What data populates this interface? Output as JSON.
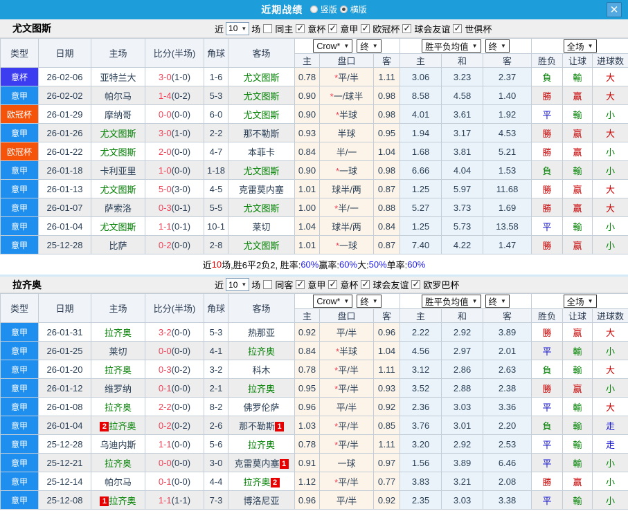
{
  "topbar": {
    "title": "近期战绩",
    "vertical_label": "竖版",
    "horizontal_label": "横版",
    "horizontal_selected": true,
    "close_icon": "✕"
  },
  "palette": {
    "topbar_blue": "#1d9dd9",
    "badge_cup_italy": "#3c3cf0",
    "badge_serie_a": "#1f8fef",
    "badge_ucl": "#f5530a",
    "team_green": "#008000",
    "score_red": "#ef4156",
    "result_red": "#c80000",
    "result_green": "#008000",
    "result_blue": "#1414d2"
  },
  "type_colors": {
    "意杯": "#3c3cf0",
    "意甲": "#1f8fef",
    "欧冠杯": "#f5530a"
  },
  "columns": {
    "type": "类型",
    "date": "日期",
    "home": "主场",
    "score": "比分(半场)",
    "corner": "角球",
    "away": "客场",
    "odds_home": "主",
    "handicap": "盘口",
    "odds_away": "客",
    "avg_home": "主",
    "avg_draw": "和",
    "avg_away": "客",
    "result": "胜负",
    "let_result": "让球",
    "goals": "进球数"
  },
  "dropdowns": {
    "company": "Crow*",
    "final": "终",
    "avg": "胜平负均值",
    "fulltime": "全场",
    "arrow": "▼"
  },
  "filter_labels": {
    "near": "近",
    "games": "场"
  },
  "sections": [
    {
      "team": "尤文图斯",
      "match_count": "10",
      "same_side_label": "同主",
      "same_side_checked": false,
      "leagues": [
        "意杯",
        "意甲",
        "欧冠杯",
        "球会友谊",
        "世俱杯"
      ],
      "rows": [
        {
          "type": "意杯",
          "date": "26-02-06",
          "home": "亚特兰大",
          "home_green": false,
          "home_badge": "",
          "score": "3-0",
          "half": "(1-0)",
          "corner": "1-6",
          "away": "尤文图斯",
          "away_green": true,
          "away_badge": "",
          "odds_home": "0.78",
          "star": true,
          "handicap": "平/半",
          "odds_away": "1.11",
          "avg_home": "3.06",
          "avg_draw": "3.23",
          "avg_away": "2.37",
          "result": "負",
          "result_color": "g",
          "let_result": "輸",
          "let_color": "g",
          "goal_result": "大",
          "goal_color": "r"
        },
        {
          "type": "意甲",
          "date": "26-02-02",
          "home": "帕尔马",
          "home_green": false,
          "home_badge": "",
          "score": "1-4",
          "half": "(0-2)",
          "corner": "5-3",
          "away": "尤文图斯",
          "away_green": true,
          "away_badge": "",
          "odds_home": "0.90",
          "star": true,
          "handicap": "一/球半",
          "odds_away": "0.98",
          "avg_home": "8.58",
          "avg_draw": "4.58",
          "avg_away": "1.40",
          "result": "勝",
          "result_color": "r",
          "let_result": "赢",
          "let_color": "r",
          "goal_result": "大",
          "goal_color": "r"
        },
        {
          "type": "欧冠杯",
          "date": "26-01-29",
          "home": "摩纳哥",
          "home_green": false,
          "home_badge": "",
          "score": "0-0",
          "half": "(0-0)",
          "corner": "6-0",
          "away": "尤文图斯",
          "away_green": true,
          "away_badge": "",
          "odds_home": "0.90",
          "star": true,
          "handicap": "半球",
          "odds_away": "0.98",
          "avg_home": "4.01",
          "avg_draw": "3.61",
          "avg_away": "1.92",
          "result": "平",
          "result_color": "b",
          "let_result": "輸",
          "let_color": "g",
          "goal_result": "小",
          "goal_color": "g"
        },
        {
          "type": "意甲",
          "date": "26-01-26",
          "home": "尤文图斯",
          "home_green": true,
          "home_badge": "",
          "score": "3-0",
          "half": "(1-0)",
          "corner": "2-2",
          "away": "那不勒斯",
          "away_green": false,
          "away_badge": "",
          "odds_home": "0.93",
          "star": false,
          "handicap": "半球",
          "odds_away": "0.95",
          "avg_home": "1.94",
          "avg_draw": "3.17",
          "avg_away": "4.53",
          "result": "勝",
          "result_color": "r",
          "let_result": "赢",
          "let_color": "r",
          "goal_result": "大",
          "goal_color": "r"
        },
        {
          "type": "欧冠杯",
          "date": "26-01-22",
          "home": "尤文图斯",
          "home_green": true,
          "home_badge": "",
          "score": "2-0",
          "half": "(0-0)",
          "corner": "4-7",
          "away": "本菲卡",
          "away_green": false,
          "away_badge": "",
          "odds_home": "0.84",
          "star": false,
          "handicap": "半/一",
          "odds_away": "1.04",
          "avg_home": "1.68",
          "avg_draw": "3.81",
          "avg_away": "5.21",
          "result": "勝",
          "result_color": "r",
          "let_result": "赢",
          "let_color": "r",
          "goal_result": "小",
          "goal_color": "g"
        },
        {
          "type": "意甲",
          "date": "26-01-18",
          "home": "卡利亚里",
          "home_green": false,
          "home_badge": "",
          "score": "1-0",
          "half": "(0-0)",
          "corner": "1-18",
          "away": "尤文图斯",
          "away_green": true,
          "away_badge": "",
          "odds_home": "0.90",
          "star": true,
          "handicap": "一球",
          "odds_away": "0.98",
          "avg_home": "6.66",
          "avg_draw": "4.04",
          "avg_away": "1.53",
          "result": "負",
          "result_color": "g",
          "let_result": "輸",
          "let_color": "g",
          "goal_result": "小",
          "goal_color": "g"
        },
        {
          "type": "意甲",
          "date": "26-01-13",
          "home": "尤文图斯",
          "home_green": true,
          "home_badge": "",
          "score": "5-0",
          "half": "(3-0)",
          "corner": "4-5",
          "away": "克雷莫内塞",
          "away_green": false,
          "away_badge": "",
          "odds_home": "1.01",
          "star": false,
          "handicap": "球半/两",
          "odds_away": "0.87",
          "avg_home": "1.25",
          "avg_draw": "5.97",
          "avg_away": "11.68",
          "result": "勝",
          "result_color": "r",
          "let_result": "赢",
          "let_color": "r",
          "goal_result": "大",
          "goal_color": "r"
        },
        {
          "type": "意甲",
          "date": "26-01-07",
          "home": "萨索洛",
          "home_green": false,
          "home_badge": "",
          "score": "0-3",
          "half": "(0-1)",
          "corner": "5-5",
          "away": "尤文图斯",
          "away_green": true,
          "away_badge": "",
          "odds_home": "1.00",
          "star": true,
          "handicap": "半/一",
          "odds_away": "0.88",
          "avg_home": "5.27",
          "avg_draw": "3.73",
          "avg_away": "1.69",
          "result": "勝",
          "result_color": "r",
          "let_result": "赢",
          "let_color": "r",
          "goal_result": "大",
          "goal_color": "r"
        },
        {
          "type": "意甲",
          "date": "26-01-04",
          "home": "尤文图斯",
          "home_green": true,
          "home_badge": "",
          "score": "1-1",
          "half": "(0-1)",
          "corner": "10-1",
          "away": "莱切",
          "away_green": false,
          "away_badge": "",
          "odds_home": "1.04",
          "star": false,
          "handicap": "球半/两",
          "odds_away": "0.84",
          "avg_home": "1.25",
          "avg_draw": "5.73",
          "avg_away": "13.58",
          "result": "平",
          "result_color": "b",
          "let_result": "輸",
          "let_color": "g",
          "goal_result": "小",
          "goal_color": "g"
        },
        {
          "type": "意甲",
          "date": "25-12-28",
          "home": "比萨",
          "home_green": false,
          "home_badge": "",
          "score": "0-2",
          "half": "(0-0)",
          "corner": "2-8",
          "away": "尤文图斯",
          "away_green": true,
          "away_badge": "",
          "odds_home": "1.01",
          "star": true,
          "handicap": "一球",
          "odds_away": "0.87",
          "avg_home": "7.40",
          "avg_draw": "4.22",
          "avg_away": "1.47",
          "result": "勝",
          "result_color": "r",
          "let_result": "赢",
          "let_color": "r",
          "goal_result": "小",
          "goal_color": "g"
        }
      ],
      "summary": [
        {
          "text": "近",
          "color": "black"
        },
        {
          "text": "10",
          "color": "red"
        },
        {
          "text": "场,胜6平2负2, 胜率:",
          "color": "black"
        },
        {
          "text": "60%",
          "color": "blue"
        },
        {
          "text": " 赢率:",
          "color": "black"
        },
        {
          "text": "60%",
          "color": "blue"
        },
        {
          "text": " 大:",
          "color": "black"
        },
        {
          "text": "50%",
          "color": "blue"
        },
        {
          "text": " 单率:",
          "color": "black"
        },
        {
          "text": "60%",
          "color": "blue"
        }
      ]
    },
    {
      "team": "拉齐奥",
      "match_count": "10",
      "same_side_label": "同客",
      "same_side_checked": false,
      "leagues": [
        "意甲",
        "意杯",
        "球会友谊",
        "欧罗巴杯"
      ],
      "rows": [
        {
          "type": "意甲",
          "date": "26-01-31",
          "home": "拉齐奥",
          "home_green": true,
          "home_badge": "",
          "score": "3-2",
          "half": "(0-0)",
          "corner": "5-3",
          "away": "热那亚",
          "away_green": false,
          "away_badge": "",
          "odds_home": "0.92",
          "star": false,
          "handicap": "平/半",
          "odds_away": "0.96",
          "avg_home": "2.22",
          "avg_draw": "2.92",
          "avg_away": "3.89",
          "result": "勝",
          "result_color": "r",
          "let_result": "赢",
          "let_color": "r",
          "goal_result": "大",
          "goal_color": "r"
        },
        {
          "type": "意甲",
          "date": "26-01-25",
          "home": "莱切",
          "home_green": false,
          "home_badge": "",
          "score": "0-0",
          "half": "(0-0)",
          "corner": "4-1",
          "away": "拉齐奥",
          "away_green": true,
          "away_badge": "",
          "odds_home": "0.84",
          "star": true,
          "handicap": "半球",
          "odds_away": "1.04",
          "avg_home": "4.56",
          "avg_draw": "2.97",
          "avg_away": "2.01",
          "result": "平",
          "result_color": "b",
          "let_result": "輸",
          "let_color": "g",
          "goal_result": "小",
          "goal_color": "g"
        },
        {
          "type": "意甲",
          "date": "26-01-20",
          "home": "拉齐奥",
          "home_green": true,
          "home_badge": "",
          "score": "0-3",
          "half": "(0-2)",
          "corner": "3-2",
          "away": "科木",
          "away_green": false,
          "away_badge": "",
          "odds_home": "0.78",
          "star": true,
          "handicap": "平/半",
          "odds_away": "1.11",
          "avg_home": "3.12",
          "avg_draw": "2.86",
          "avg_away": "2.63",
          "result": "負",
          "result_color": "g",
          "let_result": "輸",
          "let_color": "g",
          "goal_result": "大",
          "goal_color": "r"
        },
        {
          "type": "意甲",
          "date": "26-01-12",
          "home": "维罗纳",
          "home_green": false,
          "home_badge": "",
          "score": "0-1",
          "half": "(0-0)",
          "corner": "2-1",
          "away": "拉齐奥",
          "away_green": true,
          "away_badge": "",
          "odds_home": "0.95",
          "star": true,
          "handicap": "平/半",
          "odds_away": "0.93",
          "avg_home": "3.52",
          "avg_draw": "2.88",
          "avg_away": "2.38",
          "result": "勝",
          "result_color": "r",
          "let_result": "赢",
          "let_color": "r",
          "goal_result": "小",
          "goal_color": "g"
        },
        {
          "type": "意甲",
          "date": "26-01-08",
          "home": "拉齐奥",
          "home_green": true,
          "home_badge": "",
          "score": "2-2",
          "half": "(0-0)",
          "corner": "8-2",
          "away": "佛罗伦萨",
          "away_green": false,
          "away_badge": "",
          "odds_home": "0.96",
          "star": false,
          "handicap": "平/半",
          "odds_away": "0.92",
          "avg_home": "2.36",
          "avg_draw": "3.03",
          "avg_away": "3.36",
          "result": "平",
          "result_color": "b",
          "let_result": "輸",
          "let_color": "g",
          "goal_result": "大",
          "goal_color": "r"
        },
        {
          "type": "意甲",
          "date": "26-01-04",
          "home": "拉齐奥",
          "home_green": true,
          "home_badge": "2",
          "score": "0-2",
          "half": "(0-2)",
          "corner": "2-6",
          "away": "那不勒斯",
          "away_green": false,
          "away_badge": "1",
          "odds_home": "1.03",
          "star": true,
          "handicap": "平/半",
          "odds_away": "0.85",
          "avg_home": "3.76",
          "avg_draw": "3.01",
          "avg_away": "2.20",
          "result": "負",
          "result_color": "g",
          "let_result": "輸",
          "let_color": "g",
          "goal_result": "走",
          "goal_color": "b"
        },
        {
          "type": "意甲",
          "date": "25-12-28",
          "home": "乌迪内斯",
          "home_green": false,
          "home_badge": "",
          "score": "1-1",
          "half": "(0-0)",
          "corner": "5-6",
          "away": "拉齐奥",
          "away_green": true,
          "away_badge": "",
          "odds_home": "0.78",
          "star": true,
          "handicap": "平/半",
          "odds_away": "1.11",
          "avg_home": "3.20",
          "avg_draw": "2.92",
          "avg_away": "2.53",
          "result": "平",
          "result_color": "b",
          "let_result": "輸",
          "let_color": "g",
          "goal_result": "走",
          "goal_color": "b"
        },
        {
          "type": "意甲",
          "date": "25-12-21",
          "home": "拉齐奥",
          "home_green": true,
          "home_badge": "",
          "score": "0-0",
          "half": "(0-0)",
          "corner": "3-0",
          "away": "克雷莫内塞",
          "away_green": false,
          "away_badge": "1",
          "odds_home": "0.91",
          "star": false,
          "handicap": "一球",
          "odds_away": "0.97",
          "avg_home": "1.56",
          "avg_draw": "3.89",
          "avg_away": "6.46",
          "result": "平",
          "result_color": "b",
          "let_result": "輸",
          "let_color": "g",
          "goal_result": "小",
          "goal_color": "g"
        },
        {
          "type": "意甲",
          "date": "25-12-14",
          "home": "帕尔马",
          "home_green": false,
          "home_badge": "",
          "score": "0-1",
          "half": "(0-0)",
          "corner": "4-4",
          "away": "拉齐奥",
          "away_green": true,
          "away_badge": "2",
          "odds_home": "1.12",
          "star": true,
          "handicap": "平/半",
          "odds_away": "0.77",
          "avg_home": "3.83",
          "avg_draw": "3.21",
          "avg_away": "2.08",
          "result": "勝",
          "result_color": "r",
          "let_result": "赢",
          "let_color": "r",
          "goal_result": "小",
          "goal_color": "g"
        },
        {
          "type": "意甲",
          "date": "25-12-08",
          "home": "拉齐奥",
          "home_green": true,
          "home_badge": "1",
          "score": "1-1",
          "half": "(1-1)",
          "corner": "7-3",
          "away": "博洛尼亚",
          "away_green": false,
          "away_badge": "",
          "odds_home": "0.96",
          "star": false,
          "handicap": "平/半",
          "odds_away": "0.92",
          "avg_home": "2.35",
          "avg_draw": "3.03",
          "avg_away": "3.38",
          "result": "平",
          "result_color": "b",
          "let_result": "輸",
          "let_color": "g",
          "goal_result": "小",
          "goal_color": "g"
        }
      ],
      "summary": null
    }
  ]
}
